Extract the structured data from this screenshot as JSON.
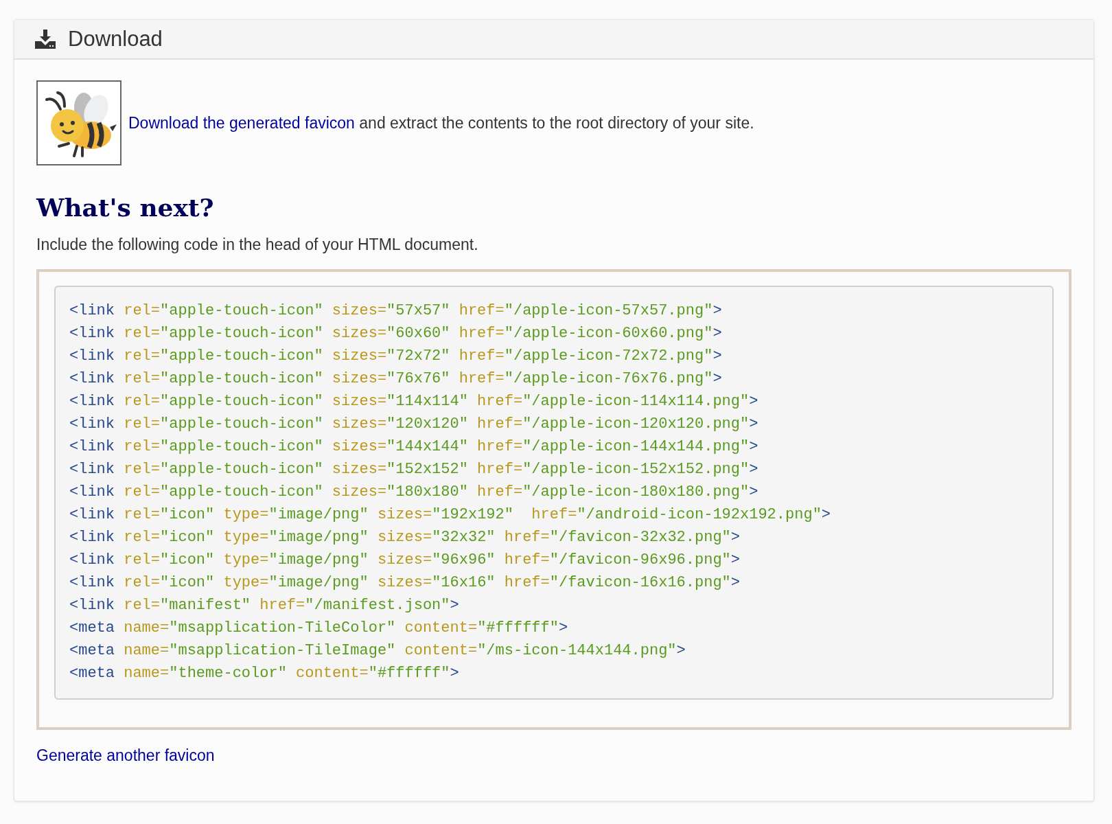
{
  "panel": {
    "title": "Download"
  },
  "intro": {
    "link": "Download the generated favicon",
    "text": " and extract the contents to the root directory of your site."
  },
  "heading": "What's next?",
  "instruction": "Include the following code in the head of your HTML document.",
  "code_lines": [
    [
      {
        "kind": "tag",
        "text": "<link"
      },
      {
        "kind": "attr",
        "text": " rel="
      },
      {
        "kind": "value",
        "text": "\"apple-touch-icon\""
      },
      {
        "kind": "attr",
        "text": " sizes="
      },
      {
        "kind": "value",
        "text": "\"57x57\""
      },
      {
        "kind": "attr",
        "text": " href="
      },
      {
        "kind": "value",
        "text": "\"/apple-icon-57x57.png\""
      },
      {
        "kind": "tag",
        "text": ">"
      }
    ],
    [
      {
        "kind": "tag",
        "text": "<link"
      },
      {
        "kind": "attr",
        "text": " rel="
      },
      {
        "kind": "value",
        "text": "\"apple-touch-icon\""
      },
      {
        "kind": "attr",
        "text": " sizes="
      },
      {
        "kind": "value",
        "text": "\"60x60\""
      },
      {
        "kind": "attr",
        "text": " href="
      },
      {
        "kind": "value",
        "text": "\"/apple-icon-60x60.png\""
      },
      {
        "kind": "tag",
        "text": ">"
      }
    ],
    [
      {
        "kind": "tag",
        "text": "<link"
      },
      {
        "kind": "attr",
        "text": " rel="
      },
      {
        "kind": "value",
        "text": "\"apple-touch-icon\""
      },
      {
        "kind": "attr",
        "text": " sizes="
      },
      {
        "kind": "value",
        "text": "\"72x72\""
      },
      {
        "kind": "attr",
        "text": " href="
      },
      {
        "kind": "value",
        "text": "\"/apple-icon-72x72.png\""
      },
      {
        "kind": "tag",
        "text": ">"
      }
    ],
    [
      {
        "kind": "tag",
        "text": "<link"
      },
      {
        "kind": "attr",
        "text": " rel="
      },
      {
        "kind": "value",
        "text": "\"apple-touch-icon\""
      },
      {
        "kind": "attr",
        "text": " sizes="
      },
      {
        "kind": "value",
        "text": "\"76x76\""
      },
      {
        "kind": "attr",
        "text": " href="
      },
      {
        "kind": "value",
        "text": "\"/apple-icon-76x76.png\""
      },
      {
        "kind": "tag",
        "text": ">"
      }
    ],
    [
      {
        "kind": "tag",
        "text": "<link"
      },
      {
        "kind": "attr",
        "text": " rel="
      },
      {
        "kind": "value",
        "text": "\"apple-touch-icon\""
      },
      {
        "kind": "attr",
        "text": " sizes="
      },
      {
        "kind": "value",
        "text": "\"114x114\""
      },
      {
        "kind": "attr",
        "text": " href="
      },
      {
        "kind": "value",
        "text": "\"/apple-icon-114x114.png\""
      },
      {
        "kind": "tag",
        "text": ">"
      }
    ],
    [
      {
        "kind": "tag",
        "text": "<link"
      },
      {
        "kind": "attr",
        "text": " rel="
      },
      {
        "kind": "value",
        "text": "\"apple-touch-icon\""
      },
      {
        "kind": "attr",
        "text": " sizes="
      },
      {
        "kind": "value",
        "text": "\"120x120\""
      },
      {
        "kind": "attr",
        "text": " href="
      },
      {
        "kind": "value",
        "text": "\"/apple-icon-120x120.png\""
      },
      {
        "kind": "tag",
        "text": ">"
      }
    ],
    [
      {
        "kind": "tag",
        "text": "<link"
      },
      {
        "kind": "attr",
        "text": " rel="
      },
      {
        "kind": "value",
        "text": "\"apple-touch-icon\""
      },
      {
        "kind": "attr",
        "text": " sizes="
      },
      {
        "kind": "value",
        "text": "\"144x144\""
      },
      {
        "kind": "attr",
        "text": " href="
      },
      {
        "kind": "value",
        "text": "\"/apple-icon-144x144.png\""
      },
      {
        "kind": "tag",
        "text": ">"
      }
    ],
    [
      {
        "kind": "tag",
        "text": "<link"
      },
      {
        "kind": "attr",
        "text": " rel="
      },
      {
        "kind": "value",
        "text": "\"apple-touch-icon\""
      },
      {
        "kind": "attr",
        "text": " sizes="
      },
      {
        "kind": "value",
        "text": "\"152x152\""
      },
      {
        "kind": "attr",
        "text": " href="
      },
      {
        "kind": "value",
        "text": "\"/apple-icon-152x152.png\""
      },
      {
        "kind": "tag",
        "text": ">"
      }
    ],
    [
      {
        "kind": "tag",
        "text": "<link"
      },
      {
        "kind": "attr",
        "text": " rel="
      },
      {
        "kind": "value",
        "text": "\"apple-touch-icon\""
      },
      {
        "kind": "attr",
        "text": " sizes="
      },
      {
        "kind": "value",
        "text": "\"180x180\""
      },
      {
        "kind": "attr",
        "text": " href="
      },
      {
        "kind": "value",
        "text": "\"/apple-icon-180x180.png\""
      },
      {
        "kind": "tag",
        "text": ">"
      }
    ],
    [
      {
        "kind": "tag",
        "text": "<link"
      },
      {
        "kind": "attr",
        "text": " rel="
      },
      {
        "kind": "value",
        "text": "\"icon\""
      },
      {
        "kind": "attr",
        "text": " type="
      },
      {
        "kind": "value",
        "text": "\"image/png\""
      },
      {
        "kind": "attr",
        "text": " sizes="
      },
      {
        "kind": "value",
        "text": "\"192x192\""
      },
      {
        "kind": "attr",
        "text": "  href="
      },
      {
        "kind": "value",
        "text": "\"/android-icon-192x192.png\""
      },
      {
        "kind": "tag",
        "text": ">"
      }
    ],
    [
      {
        "kind": "tag",
        "text": "<link"
      },
      {
        "kind": "attr",
        "text": " rel="
      },
      {
        "kind": "value",
        "text": "\"icon\""
      },
      {
        "kind": "attr",
        "text": " type="
      },
      {
        "kind": "value",
        "text": "\"image/png\""
      },
      {
        "kind": "attr",
        "text": " sizes="
      },
      {
        "kind": "value",
        "text": "\"32x32\""
      },
      {
        "kind": "attr",
        "text": " href="
      },
      {
        "kind": "value",
        "text": "\"/favicon-32x32.png\""
      },
      {
        "kind": "tag",
        "text": ">"
      }
    ],
    [
      {
        "kind": "tag",
        "text": "<link"
      },
      {
        "kind": "attr",
        "text": " rel="
      },
      {
        "kind": "value",
        "text": "\"icon\""
      },
      {
        "kind": "attr",
        "text": " type="
      },
      {
        "kind": "value",
        "text": "\"image/png\""
      },
      {
        "kind": "attr",
        "text": " sizes="
      },
      {
        "kind": "value",
        "text": "\"96x96\""
      },
      {
        "kind": "attr",
        "text": " href="
      },
      {
        "kind": "value",
        "text": "\"/favicon-96x96.png\""
      },
      {
        "kind": "tag",
        "text": ">"
      }
    ],
    [
      {
        "kind": "tag",
        "text": "<link"
      },
      {
        "kind": "attr",
        "text": " rel="
      },
      {
        "kind": "value",
        "text": "\"icon\""
      },
      {
        "kind": "attr",
        "text": " type="
      },
      {
        "kind": "value",
        "text": "\"image/png\""
      },
      {
        "kind": "attr",
        "text": " sizes="
      },
      {
        "kind": "value",
        "text": "\"16x16\""
      },
      {
        "kind": "attr",
        "text": " href="
      },
      {
        "kind": "value",
        "text": "\"/favicon-16x16.png\""
      },
      {
        "kind": "tag",
        "text": ">"
      }
    ],
    [
      {
        "kind": "tag",
        "text": "<link"
      },
      {
        "kind": "attr",
        "text": " rel="
      },
      {
        "kind": "value",
        "text": "\"manifest\""
      },
      {
        "kind": "attr",
        "text": " href="
      },
      {
        "kind": "value",
        "text": "\"/manifest.json\""
      },
      {
        "kind": "tag",
        "text": ">"
      }
    ],
    [
      {
        "kind": "tag",
        "text": "<meta"
      },
      {
        "kind": "attr",
        "text": " name="
      },
      {
        "kind": "value",
        "text": "\"msapplication-TileColor\""
      },
      {
        "kind": "attr",
        "text": " content="
      },
      {
        "kind": "value",
        "text": "\"#ffffff\""
      },
      {
        "kind": "tag",
        "text": ">"
      }
    ],
    [
      {
        "kind": "tag",
        "text": "<meta"
      },
      {
        "kind": "attr",
        "text": " name="
      },
      {
        "kind": "value",
        "text": "\"msapplication-TileImage\""
      },
      {
        "kind": "attr",
        "text": " content="
      },
      {
        "kind": "value",
        "text": "\"/ms-icon-144x144.png\""
      },
      {
        "kind": "tag",
        "text": ">"
      }
    ],
    [
      {
        "kind": "tag",
        "text": "<meta"
      },
      {
        "kind": "attr",
        "text": " name="
      },
      {
        "kind": "value",
        "text": "\"theme-color\""
      },
      {
        "kind": "attr",
        "text": " content="
      },
      {
        "kind": "value",
        "text": "\"#ffffff\""
      },
      {
        "kind": "tag",
        "text": ">"
      }
    ]
  ],
  "footer_link": "Generate another favicon"
}
